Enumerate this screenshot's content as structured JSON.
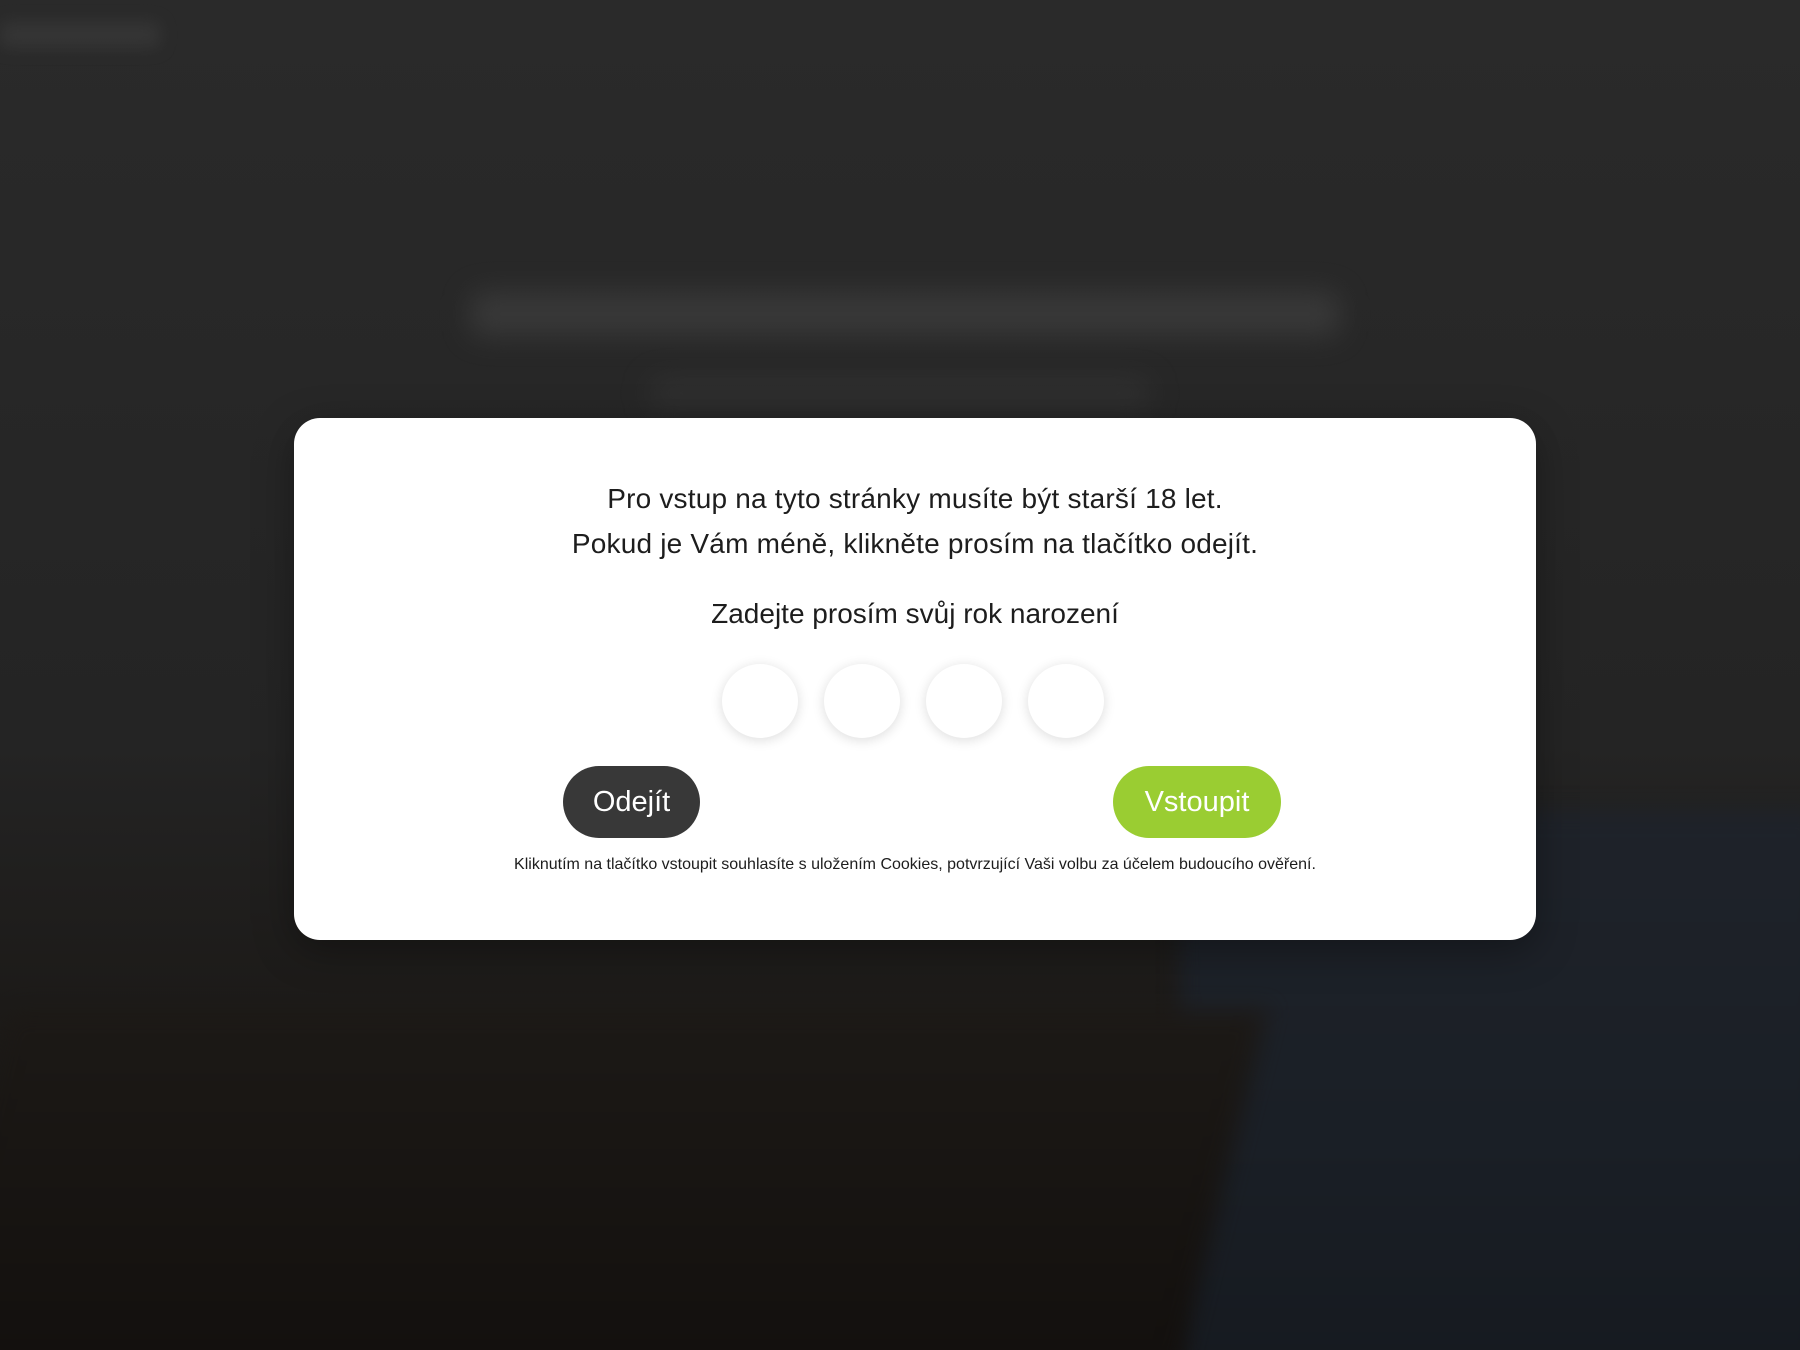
{
  "age_gate": {
    "message_line1": "Pro vstup na tyto stránky musíte být starší 18 let.",
    "message_line2": "Pokud je Vám méně, klikněte prosím na tlačítko odejít.",
    "prompt": "Zadejte prosím svůj rok narození",
    "year_digits": [
      "",
      "",
      "",
      ""
    ],
    "leave_label": "Odejít",
    "enter_label": "Vstoupit",
    "cookie_note": "Kliknutím na tlačítko vstoupit souhlasíte s uložením Cookies, potvrzující Vaši volbu za účelem budoucího ověření."
  },
  "colors": {
    "overlay": "#232323",
    "modal_bg": "#ffffff",
    "leave_button": "#383838",
    "enter_button": "#9acd32",
    "text": "#1d1d1d"
  }
}
